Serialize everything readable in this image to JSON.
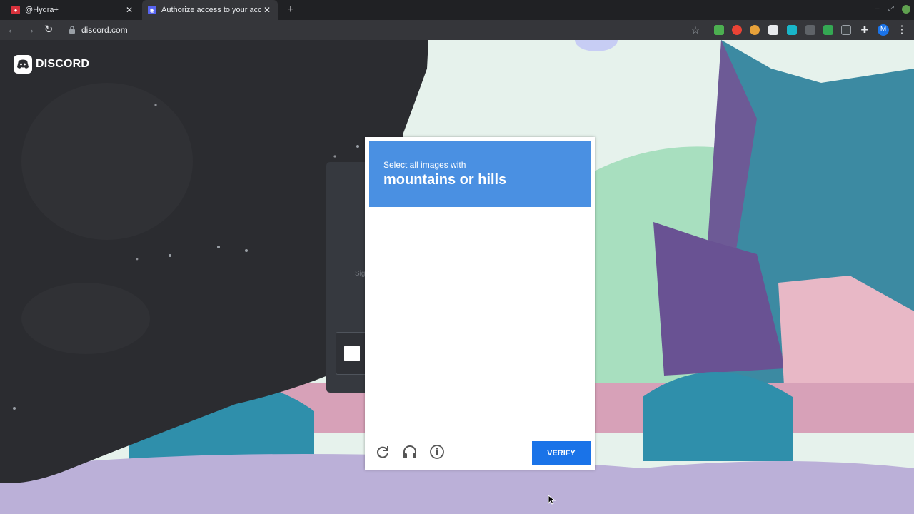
{
  "browser": {
    "tabs": [
      {
        "title": "@Hydra+",
        "active": false,
        "favicon": "hydra-favicon"
      },
      {
        "title": "Authorize access to your account",
        "active": true,
        "favicon": "discord-favicon"
      }
    ],
    "url": "discord.com",
    "window_min": "–",
    "window_restore": "⤢",
    "profile_initial": "M"
  },
  "page": {
    "brand": "DISCORD",
    "auth_card_partial_text": "Sig"
  },
  "captcha": {
    "prompt_line1": "Select all images with",
    "prompt_line2": "mountains or hills",
    "verify_label": "VERIFY",
    "header_color": "#4a90e2",
    "button_color": "#1a73e8"
  }
}
